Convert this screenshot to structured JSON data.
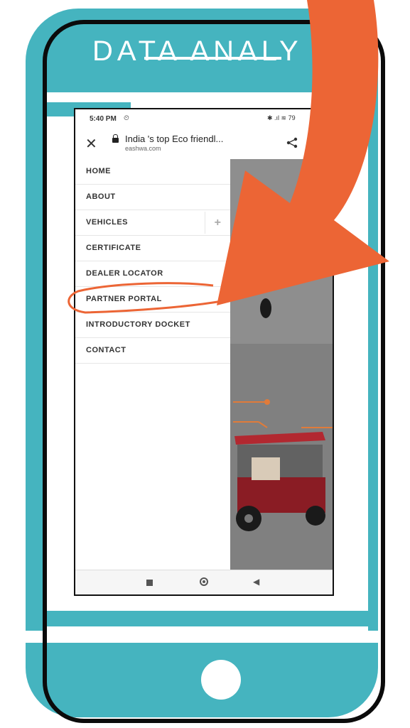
{
  "poster": {
    "title": "DATA ANALY",
    "accent_color": "#45b4bf",
    "arrow_color": "#ec6535"
  },
  "status_bar": {
    "time": "5:40 PM",
    "alarm_icon": "alarm-icon",
    "icons": "✱ .ıl ≋ 79"
  },
  "browser": {
    "page_title": "India 's top Eco friendl...",
    "domain": "eashwa.com",
    "close_icon": "close-icon",
    "share_icon": "share-icon"
  },
  "menu": {
    "items": [
      {
        "label": "HOME"
      },
      {
        "label": "ABOUT"
      },
      {
        "label": "VEHICLES",
        "expand": "+"
      },
      {
        "label": "CERTIFICATE"
      },
      {
        "label": "DEALER LOCATOR"
      },
      {
        "label": "PARTNER PORTAL"
      },
      {
        "label": "INTRODUCTORY DOCKET"
      },
      {
        "label": "CONTACT"
      }
    ]
  },
  "nav_bar": {
    "icons": [
      "square-icon",
      "home-circle-icon",
      "back-triangle-icon"
    ]
  }
}
